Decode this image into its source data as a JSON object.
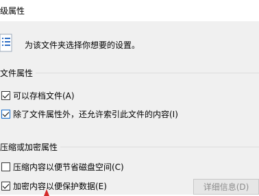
{
  "window": {
    "title": "级属性"
  },
  "header": {
    "description": "为该文件夹选择你想要的设置。"
  },
  "file_attributes": {
    "title": "文件属性",
    "options": [
      {
        "label": "可以存档文件(A)",
        "checked": true
      },
      {
        "label": "除了文件属性外，还允许索引此文件的内容(I)",
        "checked": true
      }
    ]
  },
  "compress_encrypt": {
    "title": "压缩或加密属性",
    "options": [
      {
        "label": "压缩内容以便节省磁盘空间(C)",
        "checked": false
      },
      {
        "label": "加密内容以便保护数据(E)",
        "checked": true
      }
    ],
    "details_button": "详细信息(D)"
  },
  "icons": {
    "folder": "folder-settings-icon",
    "cursor": "cursor-arrow-icon"
  }
}
